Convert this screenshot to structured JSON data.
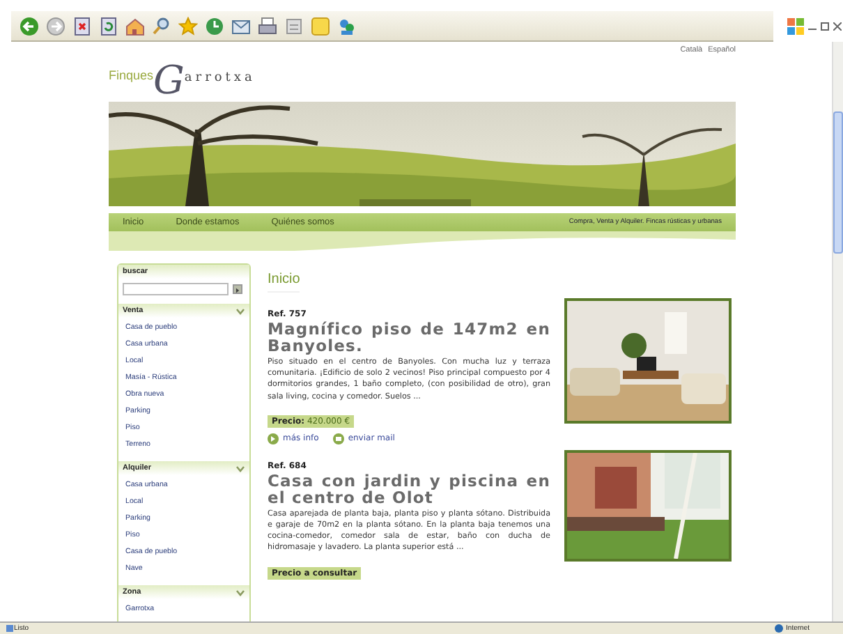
{
  "browser": {
    "status": "Listo",
    "zone": "Internet"
  },
  "site": {
    "languages": [
      "Català",
      "Español"
    ],
    "logo": {
      "prefix": "Finques",
      "initial": "G",
      "rest": "arrotxa"
    },
    "nav": [
      "Inicio",
      "Donde estamos",
      "Quiénes somos"
    ],
    "tagline": "Compra, Venta y Alquiler. Fincas rústicas y urbanas"
  },
  "sidebar": {
    "search_title": "buscar",
    "sections": [
      {
        "title": "Venta",
        "items": [
          "Casa de pueblo",
          "Casa urbana",
          "Local",
          "Masía - Rústica",
          "Obra nueva",
          "Parking",
          "Piso",
          "Terreno"
        ]
      },
      {
        "title": "Alquiler",
        "items": [
          "Casa urbana",
          "Local",
          "Parking",
          "Piso",
          "Casa de pueblo",
          "Nave"
        ]
      },
      {
        "title": "Zona",
        "items": [
          "Garrotxa"
        ]
      }
    ]
  },
  "main": {
    "heading": "Inicio",
    "listings": [
      {
        "ref": "Ref. 757",
        "title": "Magnífico piso de 147m2 en Banyoles.",
        "description": "Piso situado en el centro de Banyoles. Con mucha luz y terraza comunitaria. ¡Edificio de solo 2 vecinos! Piso principal compuesto por 4 dormitorios grandes, 1 baño completo, (con posibilidad de otro), gran sala living, cocina y comedor. Suelos ...",
        "price": "**Precio:** 420.000 €",
        "kind": "interior",
        "links": [
          "más info",
          "enviar mail"
        ]
      },
      {
        "ref": "Ref. 684",
        "title": "Casa con jardin y piscina en el centro de Olot",
        "description": "Casa aparejada de planta baja, planta piso y planta sótano. Distribuida e garaje de 70m2 en la planta sótano. En la planta baja tenemos una cocina-comedor, comedor sala de estar, baño con ducha de hidromasaje y lavadero. La planta superior está ...",
        "price": "**Precio a consultar**",
        "kind": "garden"
      }
    ]
  }
}
